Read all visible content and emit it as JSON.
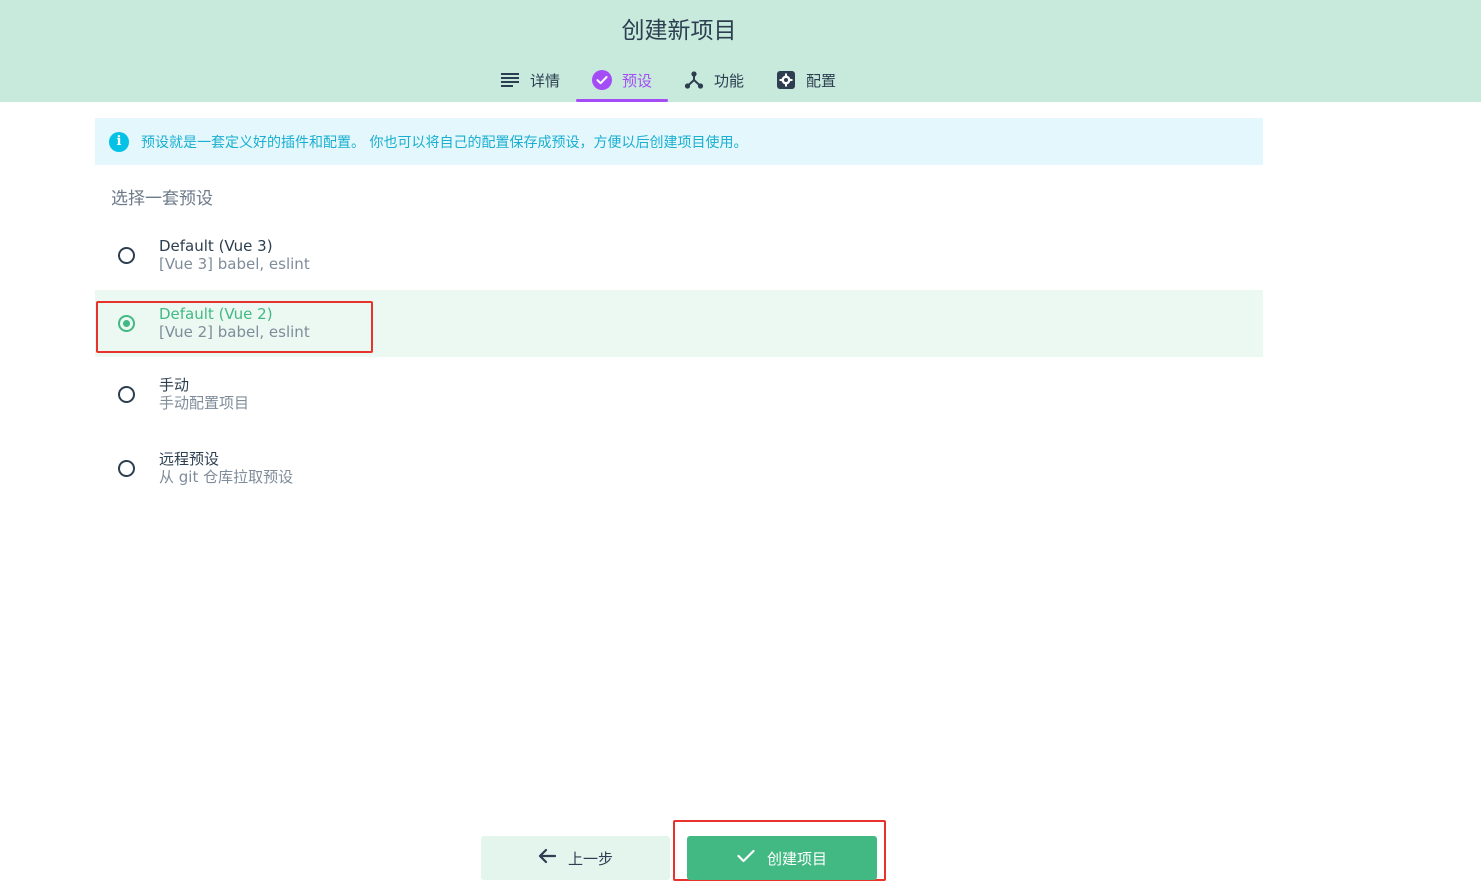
{
  "page": {
    "title": "创建新项目"
  },
  "tabs": [
    {
      "label": "详情",
      "icon": "list-icon"
    },
    {
      "label": "预设",
      "icon": "check-circle-icon",
      "active": true
    },
    {
      "label": "功能",
      "icon": "fork-icon"
    },
    {
      "label": "配置",
      "icon": "settings-gear-icon"
    }
  ],
  "info": {
    "text": "预设就是一套定义好的插件和配置。 你也可以将自己的配置保存成预设，方便以后创建项目使用。"
  },
  "section": {
    "title": "选择一套预设"
  },
  "presets": [
    {
      "name": "Default (Vue 3)",
      "desc": "[Vue 3] babel, eslint",
      "selected": false
    },
    {
      "name": "Default (Vue 2)",
      "desc": "[Vue 2] babel, eslint",
      "selected": true
    },
    {
      "name": "手动",
      "desc": "手动配置项目",
      "selected": false
    },
    {
      "name": "远程预设",
      "desc": "从 git 仓库拉取预设",
      "selected": false
    }
  ],
  "footer": {
    "prev_label": "上一步",
    "create_label": "创建项目"
  },
  "colors": {
    "header_bg": "#c8eadd",
    "accent_purple": "#a44cf6",
    "accent_green": "#42b983",
    "info_bg": "#e3f7fc",
    "info_text": "#1aafd0",
    "highlight_red": "#e8322c"
  }
}
